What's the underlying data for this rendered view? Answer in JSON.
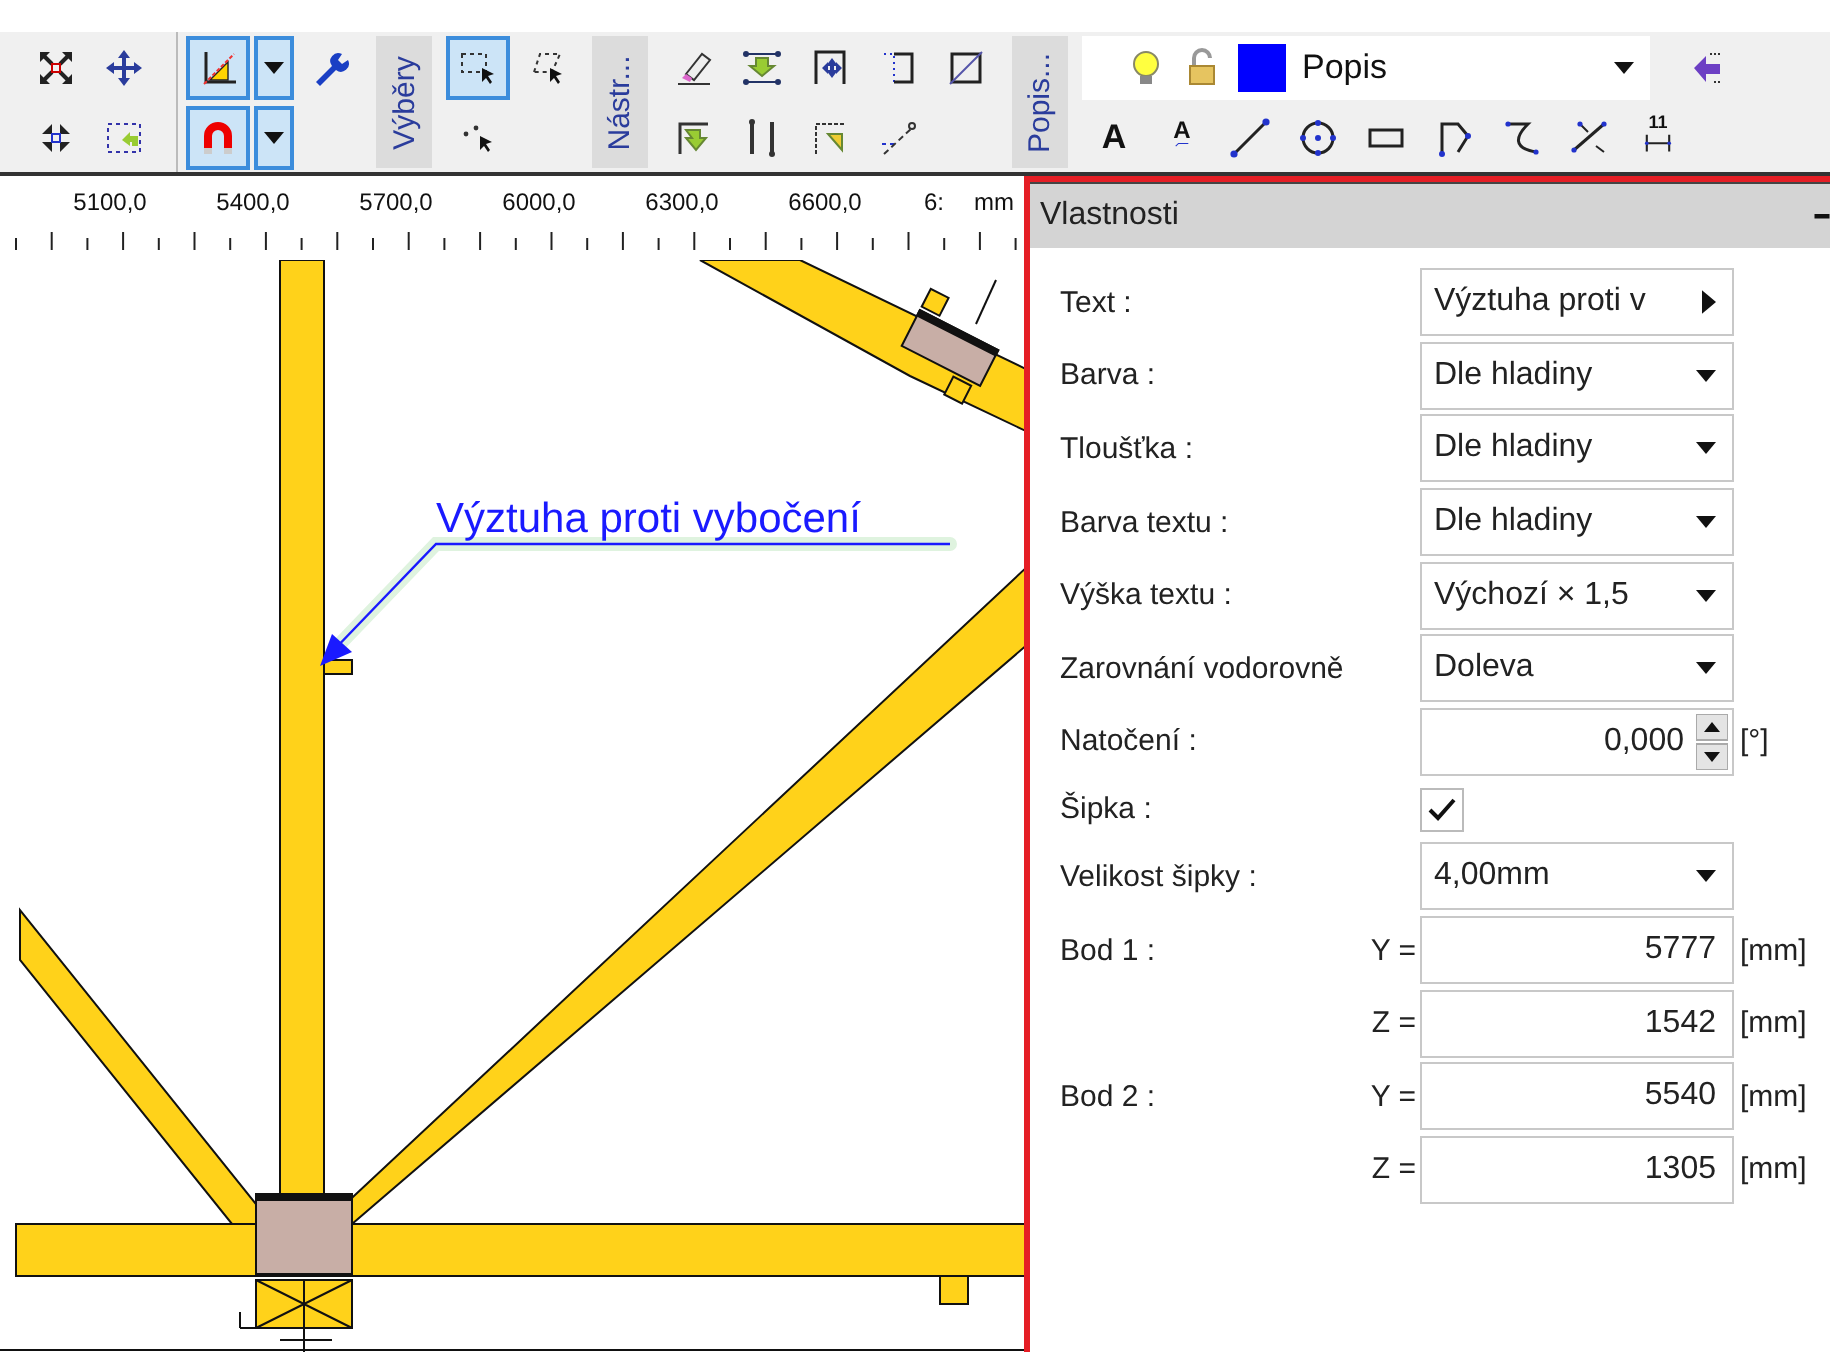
{
  "toolbar": {
    "sections": [
      {
        "rows": [
          [
            {
              "kind": "expand",
              "selected": false
            },
            {
              "kind": "move",
              "selected": false
            }
          ],
          [
            {
              "kind": "collapse",
              "selected": false
            },
            {
              "kind": "frameback",
              "selected": false
            }
          ]
        ]
      },
      {
        "rows": [
          [
            {
              "kind": "axes",
              "selected": true,
              "dropdown": true
            },
            {
              "kind": "wrench",
              "selected": false
            }
          ],
          [
            {
              "kind": "magnet",
              "selected": true,
              "dropdown": true
            }
          ]
        ]
      },
      {
        "label": "Výběry",
        "rows": [
          [
            {
              "kind": "rectselect",
              "selected": true
            },
            {
              "kind": "polyselect",
              "selected": false
            }
          ],
          [
            {
              "kind": "pointselect",
              "selected": false
            }
          ]
        ]
      },
      {
        "label": "Nástr...",
        "rows": [
          [
            {
              "kind": "eraser",
              "selected": false
            },
            {
              "kind": "downarrow",
              "selected": false
            },
            {
              "kind": "framemove",
              "selected": false
            },
            {
              "kind": "outline",
              "selected": false
            },
            {
              "kind": "diagonal",
              "selected": false
            }
          ],
          [
            {
              "kind": "turnarrow",
              "selected": false
            },
            {
              "kind": "bars",
              "selected": false
            },
            {
              "kind": "cornerarrow",
              "selected": false
            },
            {
              "kind": "dashline",
              "selected": false
            }
          ]
        ]
      },
      {
        "label": "Popis...",
        "layer": {
          "name": "Popis",
          "color": "#0000ff"
        },
        "rows": [
          [
            {
              "kind": "layerarrow",
              "selected": false
            }
          ],
          [
            {
              "kind": "letter",
              "glyph": "A",
              "selected": false
            },
            {
              "kind": "letterline",
              "glyph": "A",
              "selected": false
            },
            {
              "kind": "line",
              "selected": false
            },
            {
              "kind": "circle",
              "selected": false
            },
            {
              "kind": "rect",
              "selected": false
            },
            {
              "kind": "polyline",
              "selected": false
            },
            {
              "kind": "curve",
              "selected": false
            },
            {
              "kind": "points",
              "selected": false
            },
            {
              "kind": "dimension",
              "glyph": "11",
              "selected": false
            }
          ]
        ]
      }
    ]
  },
  "ruler": {
    "labels": [
      "5100,0",
      "5400,0",
      "5700,0",
      "6000,0",
      "6300,0",
      "6600,0",
      "6:"
    ],
    "unit": "mm"
  },
  "canvas": {
    "annotation": "Výztuha proti vybočení"
  },
  "panel": {
    "title": "Vlastnosti",
    "rows": [
      {
        "kind": "text",
        "label": "Text :",
        "value": "Výztuha proti v"
      },
      {
        "kind": "select",
        "label": "Barva :",
        "value": "Dle hladiny"
      },
      {
        "kind": "select",
        "label": "Tloušťka :",
        "value": "Dle hladiny"
      },
      {
        "kind": "select",
        "label": "Barva textu :",
        "value": "Dle hladiny"
      },
      {
        "kind": "select",
        "label": "Výška textu :",
        "value": "Výchozí × 1,5"
      },
      {
        "kind": "select",
        "label": "Zarovnání vodorovně",
        "value": "Doleva"
      },
      {
        "kind": "spin",
        "label": "Natočení :",
        "value": "0,000",
        "unit": "[°]"
      },
      {
        "kind": "check",
        "label": "Šipka :",
        "checked": true
      },
      {
        "kind": "select",
        "label": "Velikost šipky :",
        "value": "4,00mm"
      },
      {
        "kind": "coord",
        "label": "Bod 1 :",
        "axis": "Y =",
        "value": "5777",
        "unit": "[mm]"
      },
      {
        "kind": "coord",
        "axis": "Z =",
        "value": "1542",
        "unit": "[mm]"
      },
      {
        "kind": "coord",
        "label": "Bod 2 :",
        "axis": "Y =",
        "value": "5540",
        "unit": "[mm]"
      },
      {
        "kind": "coord",
        "axis": "Z =",
        "value": "1305",
        "unit": "[mm]"
      }
    ]
  }
}
